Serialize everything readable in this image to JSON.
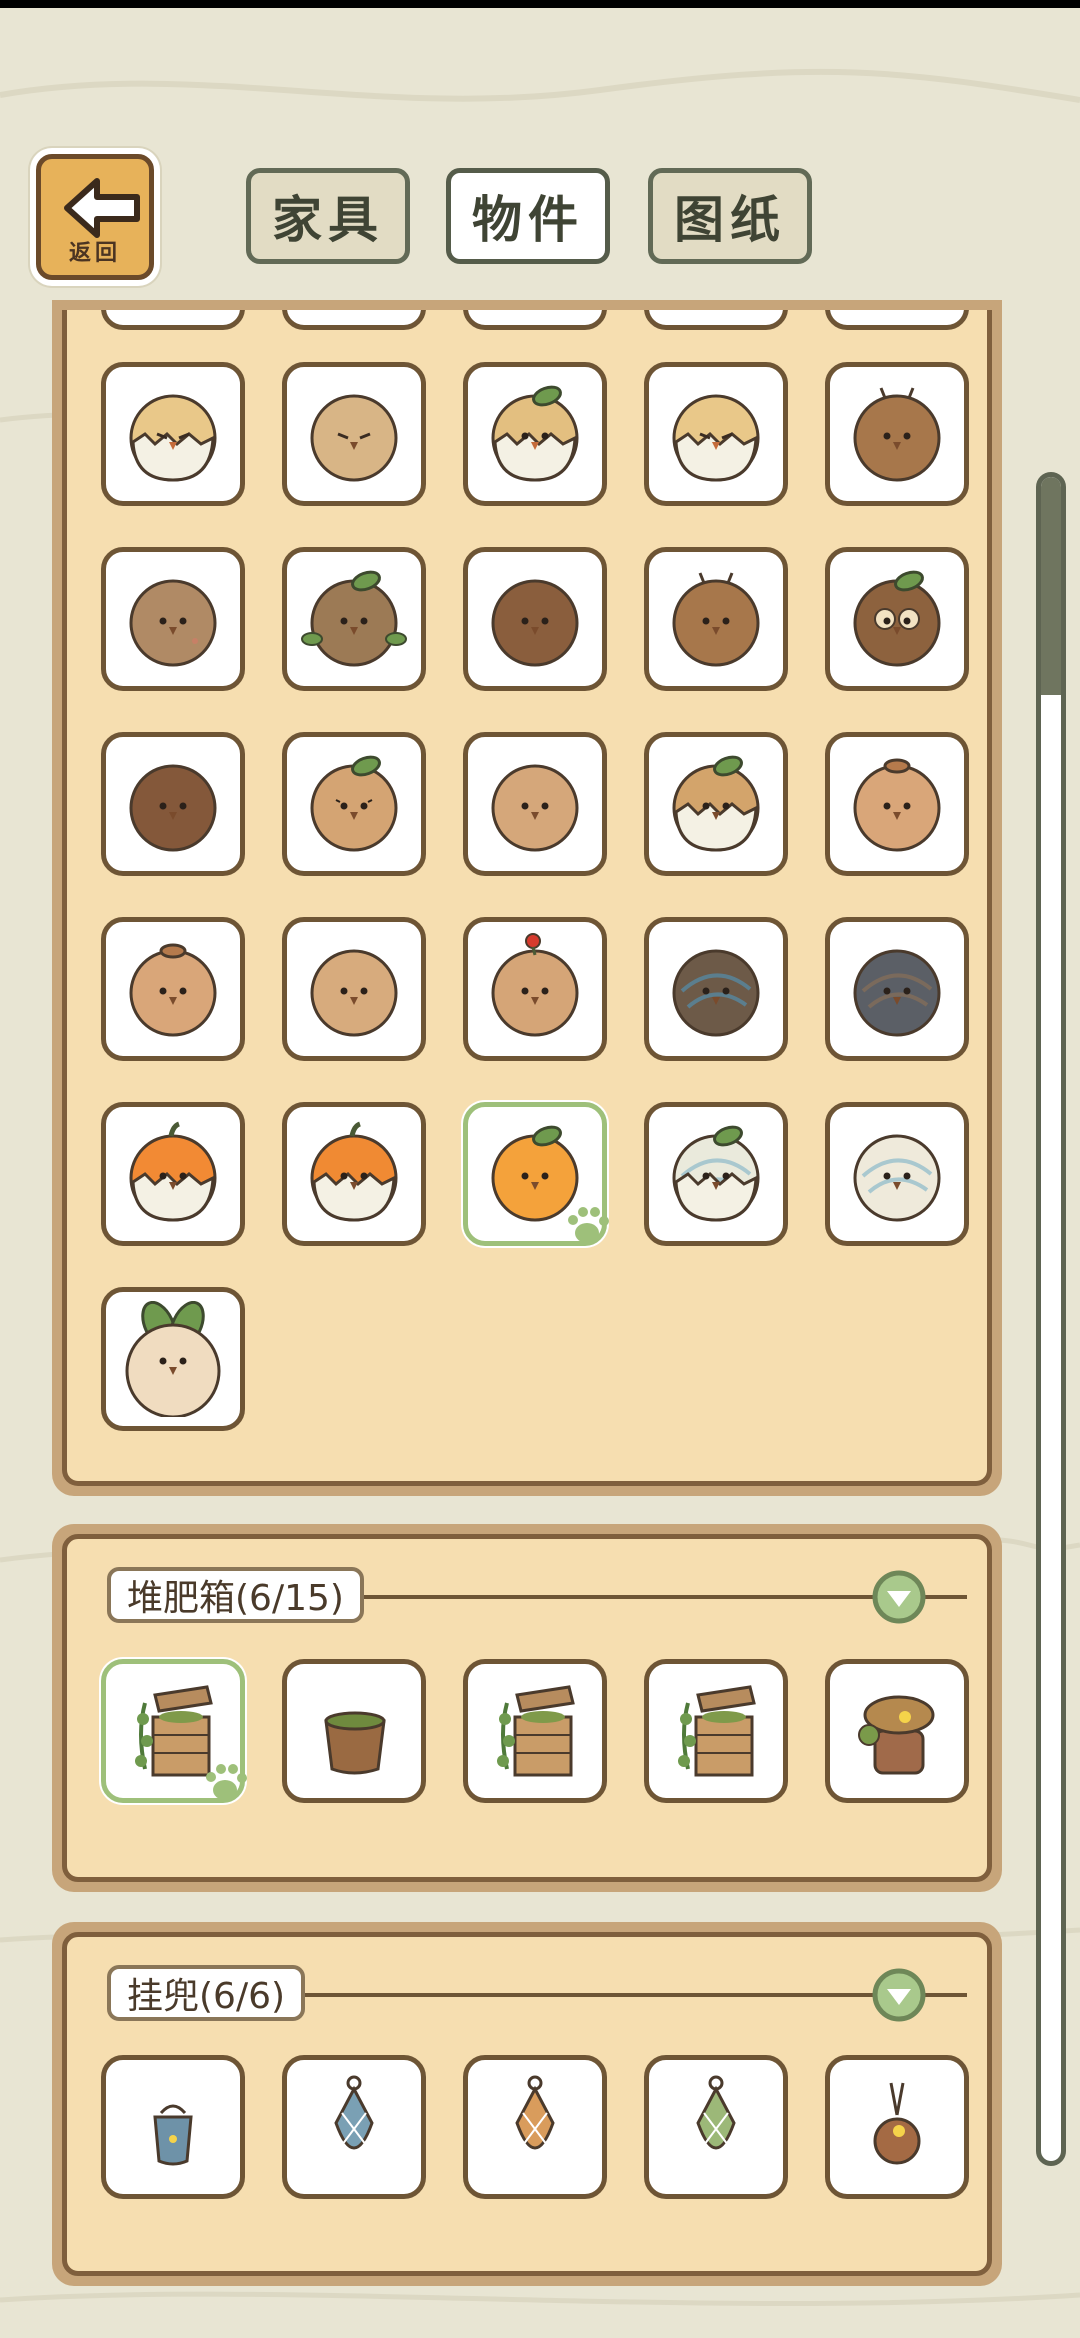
{
  "header": {
    "back_label": "返回",
    "tabs": [
      {
        "label": "家具",
        "active": false
      },
      {
        "label": "物件",
        "active": true
      },
      {
        "label": "图纸",
        "active": false
      }
    ]
  },
  "grid": {
    "rows": [
      [
        "white-cracked-egg-bird",
        "sleepy-seed",
        "cracked-sprout-seed",
        "white-cracked-egg-bird",
        "brown-antenna-seed"
      ],
      [
        "plain-brown-seed",
        "leaf-sprout-seed",
        "dark-round-seed",
        "brown-antenna-seed",
        "owl-leaf-seed"
      ],
      [
        "dark-brown-seed",
        "leaf-face-seed",
        "tan-seed",
        "sprout-egg-seed",
        "capped-seed"
      ],
      [
        "capped-seed",
        "plain-tan-seed",
        "cherry-sprout-seed",
        "blue-marbled-seed",
        "grey-marbled-seed"
      ],
      [
        "orange-cracked-pumpkin",
        "pumpkin-vine",
        "orange-fruit-bird",
        "white-sprout-egg",
        "white-swirl-egg"
      ],
      [
        "leafy-white-seed"
      ]
    ],
    "selected": "orange-fruit-bird"
  },
  "compost": {
    "label": "堆肥箱(6/15)",
    "items": [
      "vine-crate",
      "wood-pot",
      "vine-crate",
      "vine-crate",
      "mushroom-stump"
    ],
    "selected": 0
  },
  "pouch": {
    "label": "挂兜(6/6)",
    "items": [
      "blue-bucket",
      "blue-net-bag",
      "orange-net-bag",
      "green-net-bag",
      "flower-pouch"
    ]
  },
  "colors": {
    "panel_bg": "#f6deb0",
    "panel_border": "#7f5f3d",
    "selected_border": "#9ec07a",
    "tab_border": "#626a56"
  }
}
